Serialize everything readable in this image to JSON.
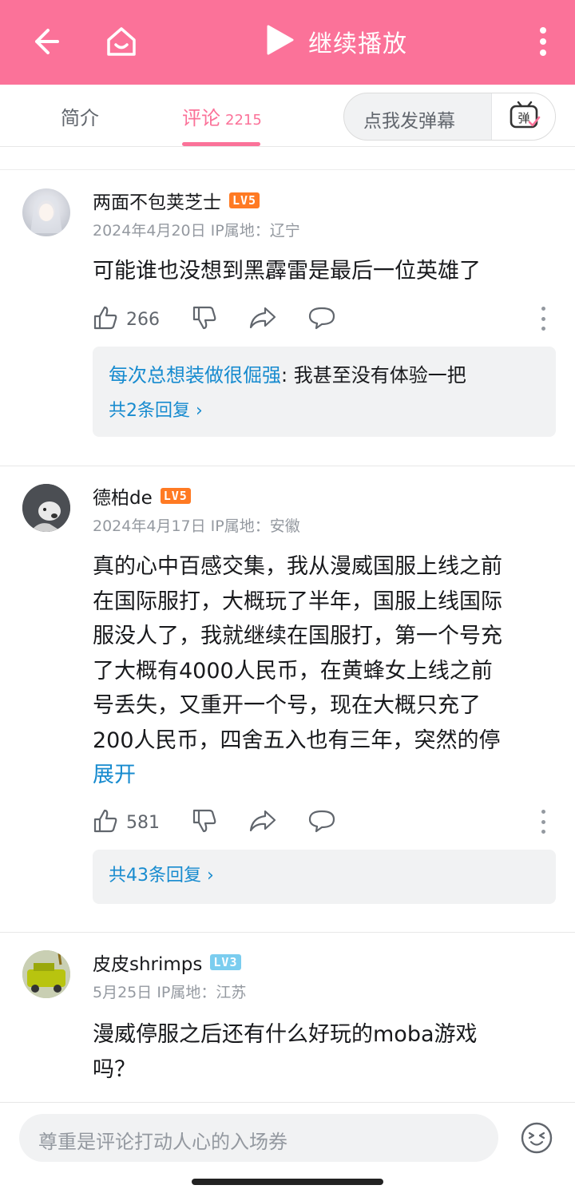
{
  "header": {
    "play_label": "继续播放",
    "icons": [
      "back-arrow-icon",
      "home-icon",
      "play-icon",
      "more-vertical-icon"
    ],
    "bg_color": "#fb7299"
  },
  "tabs": {
    "intro_label": "简介",
    "comments_label": "评论",
    "comments_count": "2215",
    "danmaku_placeholder": "点我发弹幕",
    "danmaku_icon_char": "弹"
  },
  "comments": [
    {
      "username": "两面不包荚芝士",
      "level": "LV5",
      "date": "2024年4月20日",
      "ip": "IP属地：辽宁",
      "text": "可能谁也没想到黑霹雷是最后一位英雄了",
      "likes": "266",
      "reply_preview_user": "每次总想装做很倔强",
      "reply_preview_text": ": 我甚至没有体验一把",
      "reply_count": "共2条回复 ›"
    },
    {
      "username": "德柏de",
      "level": "LV5",
      "date": "2024年4月17日",
      "ip": "IP属地：安徽",
      "lines": [
        "真的心中百感交集，我从漫威国服上线之前",
        "在国际服打，大概玩了半年，国服上线国际",
        "服没人了，我就继续在国服打，第一个号充",
        "了大概有4000人民币，在黄蜂女上线之前",
        "号丢失，又重开一个号，现在大概只充了",
        "200人民币，四舍五入也有三年，突然的停"
      ],
      "expand_label": "展开",
      "likes": "581",
      "reply_count": "共43条回复 ›"
    },
    {
      "username": "皮皮shrimps",
      "level": "LV3",
      "date": "5月25日",
      "ip": "IP属地：江苏",
      "lines": [
        "漫威停服之后还有什么好玩的moba游戏",
        "吗？"
      ]
    }
  ],
  "bottom": {
    "input_placeholder": "尊重是评论打动人心的入场券"
  }
}
